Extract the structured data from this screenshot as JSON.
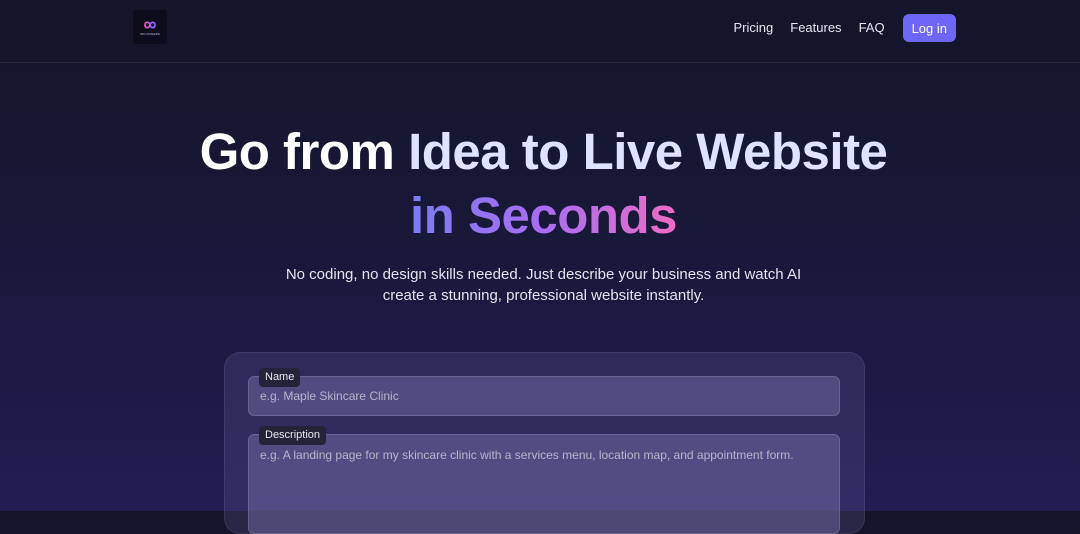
{
  "nav": {
    "logo_icon": "infinity-icon",
    "logo_text": "INFINIWEBS",
    "links": [
      "Pricing",
      "Features",
      "FAQ"
    ],
    "login_label": "Log in"
  },
  "hero": {
    "title_part1": "Go from ",
    "title_part2": "Idea to Live Website",
    "title_line2": "in Seconds",
    "subtitle_line1": "No coding, no design skills needed. Just describe your business and watch AI",
    "subtitle_line2": "create a stunning, professional website instantly."
  },
  "form": {
    "name_label": "Name",
    "name_placeholder": "e.g. Maple Skincare Clinic",
    "description_label": "Description",
    "description_placeholder": "e.g. A landing page for my skincare clinic with a services menu, location map, and appointment form."
  },
  "colors": {
    "accent": "#6e66f7",
    "background_top": "#14152b",
    "background_bottom": "#211c52",
    "gradient_start": "#7b7bf4",
    "gradient_end": "#f06bc4"
  }
}
